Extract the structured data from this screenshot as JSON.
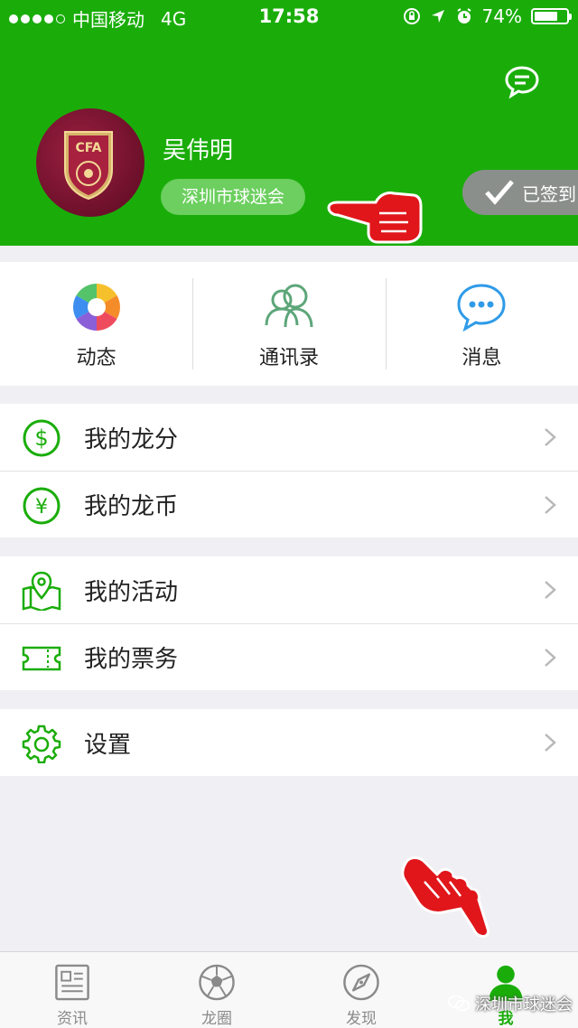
{
  "status_bar": {
    "carrier": "中国移动",
    "network": "4G",
    "time": "17:58",
    "battery": "74%",
    "battery_level": 0.74
  },
  "profile": {
    "name": "吴伟明",
    "club": "深圳市球迷会",
    "checkin_label": "已签到",
    "avatar_text": "CFA"
  },
  "quick_actions": [
    {
      "label": "动态",
      "icon": "moments-icon"
    },
    {
      "label": "通讯录",
      "icon": "contacts-icon"
    },
    {
      "label": "消息",
      "icon": "message-icon"
    }
  ],
  "menu": {
    "points": "我的龙分",
    "coins": "我的龙币",
    "activities": "我的活动",
    "tickets": "我的票务",
    "settings": "设置"
  },
  "tabs": [
    {
      "label": "资讯",
      "icon": "news-icon"
    },
    {
      "label": "龙圈",
      "icon": "football-icon"
    },
    {
      "label": "发现",
      "icon": "compass-icon"
    },
    {
      "label": "我",
      "icon": "person-icon",
      "active": true
    }
  ],
  "watermark": "深圳市球迷会",
  "colors": {
    "brand_green": "#1aad0a",
    "badge_green": "#6ccf5f",
    "checkin_gray": "#8a8f8c",
    "pointer_red": "#e0161b"
  }
}
